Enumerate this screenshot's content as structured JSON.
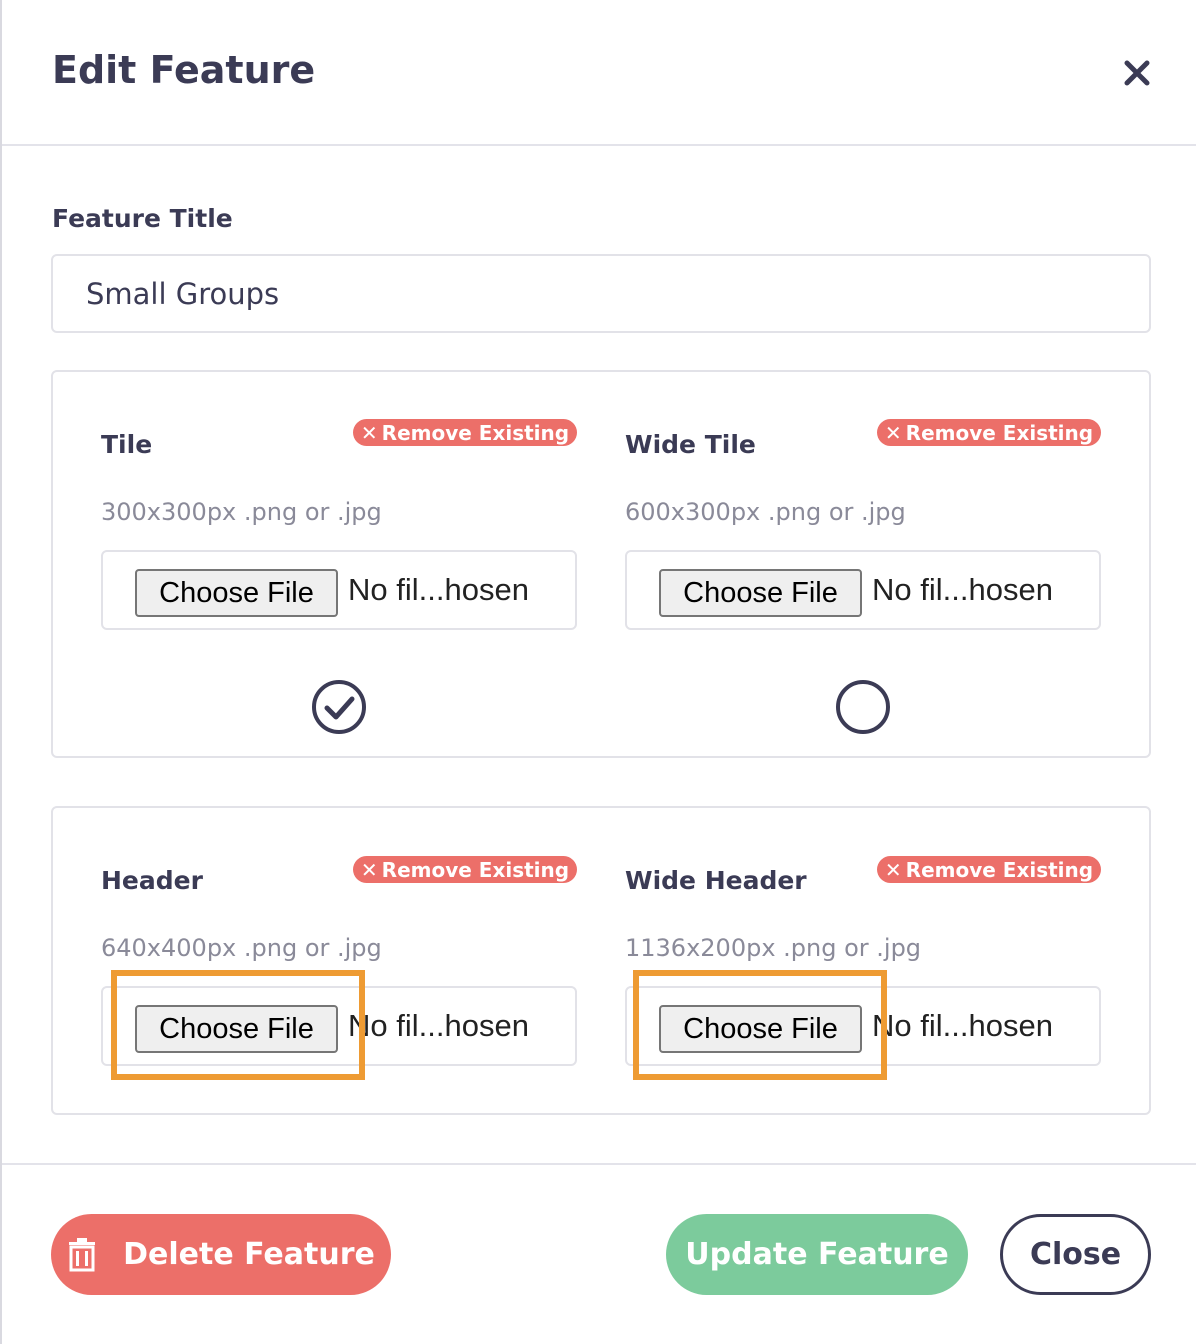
{
  "modal": {
    "title": "Edit Feature",
    "close_icon": "close-icon"
  },
  "feature_title": {
    "label": "Feature Title",
    "value": "Small Groups"
  },
  "remove_label": "Remove Existing",
  "remove_x": "✕",
  "slots": [
    {
      "label": "Tile",
      "hint": "300x300px .png or .jpg",
      "choose_label": "Choose File",
      "file_status": "No fil...hosen",
      "selected": true,
      "indicator_icon": "check-circle-icon"
    },
    {
      "label": "Wide Tile",
      "hint": "600x300px .png or .jpg",
      "choose_label": "Choose File",
      "file_status": "No fil...hosen",
      "selected": false,
      "indicator_icon": "empty-circle-icon"
    },
    {
      "label": "Header",
      "hint": "640x400px .png or .jpg",
      "choose_label": "Choose File",
      "file_status": "No fil...hosen",
      "highlighted": true
    },
    {
      "label": "Wide Header",
      "hint": "1136x200px .png or .jpg",
      "choose_label": "Choose File",
      "file_status": "No fil...hosen",
      "highlighted": true
    }
  ],
  "footer": {
    "delete_label": "Delete Feature",
    "update_label": "Update Feature",
    "close_label": "Close",
    "delete_icon": "trash-icon"
  },
  "colors": {
    "danger": "#ec6f69",
    "success": "#7ccb9c",
    "text": "#3b3b55",
    "muted": "#8a8a99",
    "highlight": "#ee9b33"
  }
}
